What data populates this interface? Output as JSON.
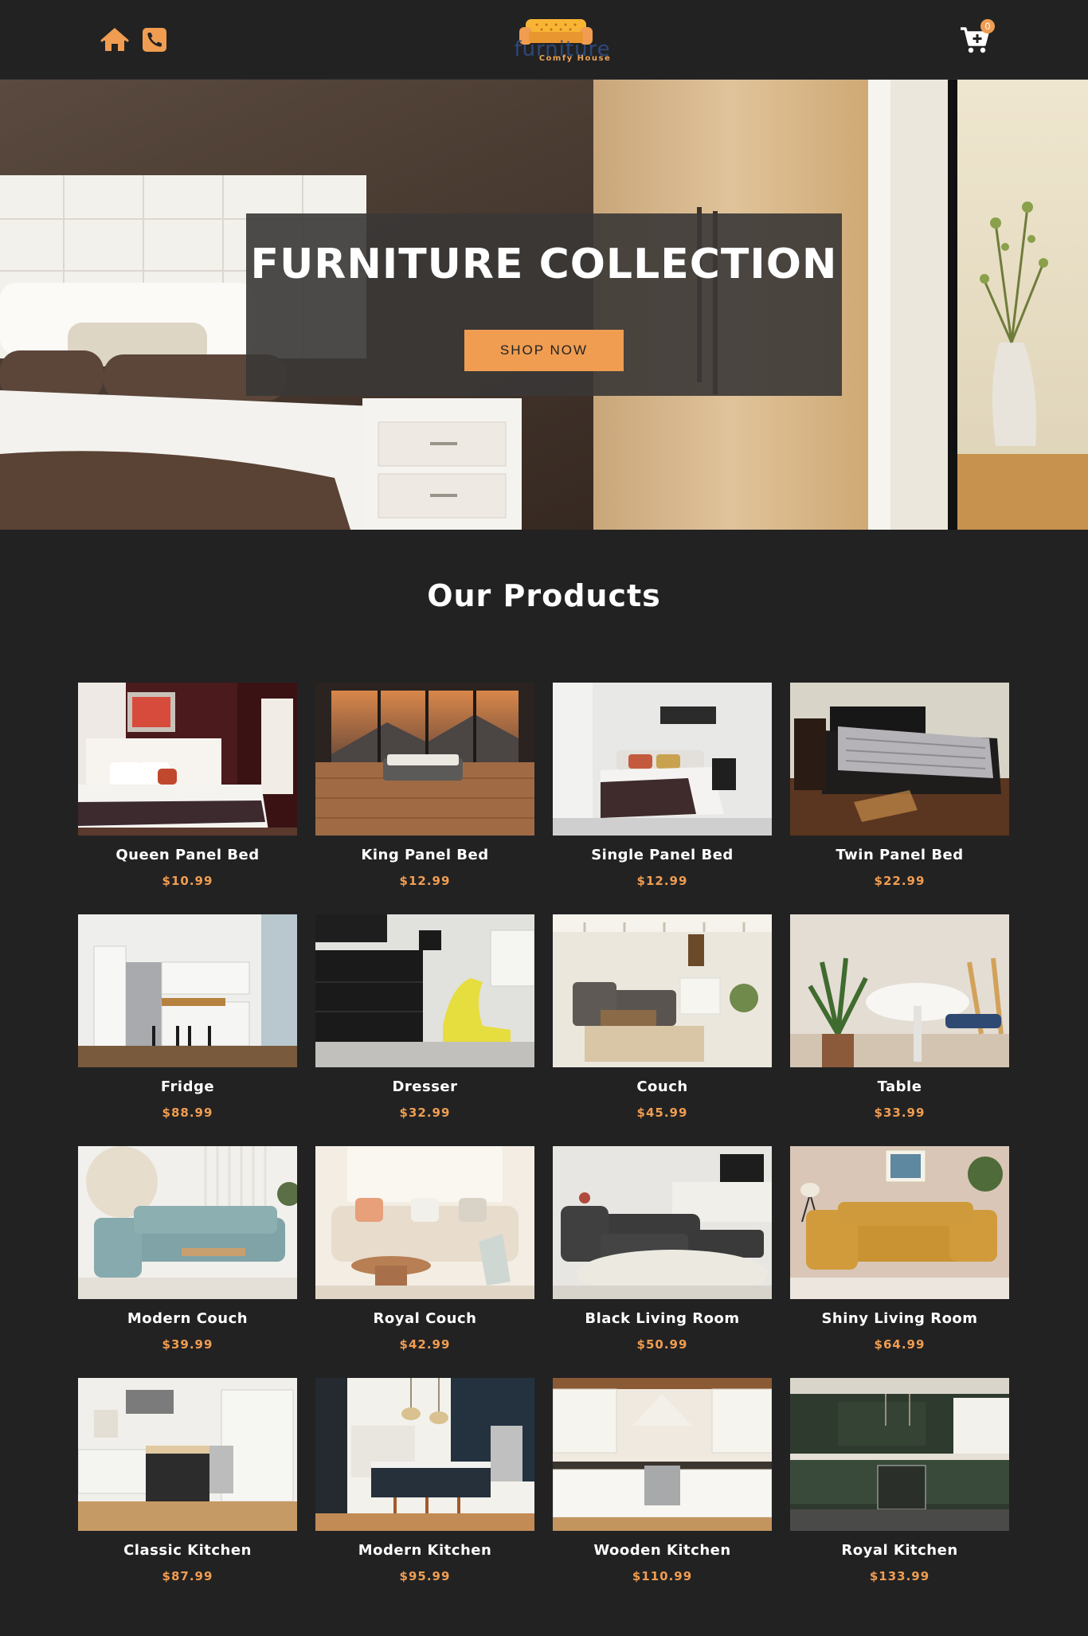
{
  "navbar": {
    "icons": [
      "home-icon",
      "phone-icon",
      "cart-icon"
    ],
    "logo": {
      "text_main": "furniture",
      "text_sub": "Comfy House"
    },
    "cart_count": "0"
  },
  "hero": {
    "title": "FURNITURE COLLECTION",
    "button_label": "SHOP NOW"
  },
  "products_section": {
    "title": "Our Products",
    "items": [
      {
        "name": "Queen Panel Bed",
        "price": "$10.99"
      },
      {
        "name": "King Panel Bed",
        "price": "$12.99"
      },
      {
        "name": "Single Panel Bed",
        "price": "$12.99"
      },
      {
        "name": "Twin Panel Bed",
        "price": "$22.99"
      },
      {
        "name": "Fridge",
        "price": "$88.99"
      },
      {
        "name": "Dresser",
        "price": "$32.99"
      },
      {
        "name": "Couch",
        "price": "$45.99"
      },
      {
        "name": "Table",
        "price": "$33.99"
      },
      {
        "name": "Modern Couch",
        "price": "$39.99"
      },
      {
        "name": "Royal Couch",
        "price": "$42.99"
      },
      {
        "name": "Black Living Room",
        "price": "$50.99"
      },
      {
        "name": "Shiny Living Room",
        "price": "$64.99"
      },
      {
        "name": "Classic Kitchen",
        "price": "$87.99"
      },
      {
        "name": "Modern Kitchen",
        "price": "$95.99"
      },
      {
        "name": "Wooden Kitchen",
        "price": "$110.99"
      },
      {
        "name": "Royal Kitchen",
        "price": "$133.99"
      }
    ]
  },
  "colors": {
    "background": "#222223",
    "accent": "#f09d51",
    "text": "#ffffff"
  }
}
